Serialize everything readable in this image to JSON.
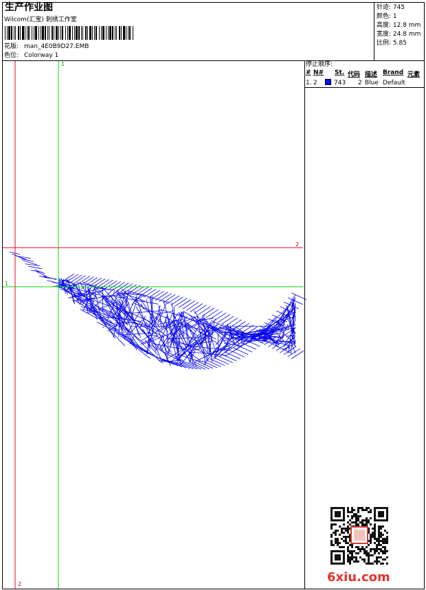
{
  "header": {
    "title": "生产作业图",
    "company": "Wilcom(汇宝) 刺绣工作室",
    "design_label": "花版:",
    "design_value": "man_4E0B9D27.EMB",
    "colorway_label": "色位:",
    "colorway_value": "Colorway 1"
  },
  "stats": [
    {
      "label": "针迹:",
      "value": "745"
    },
    {
      "label": "颜色:",
      "value": "1"
    },
    {
      "label": "高度:",
      "value": "12.8 mm"
    },
    {
      "label": "宽度:",
      "value": "24.8 mm"
    },
    {
      "label": "比例:",
      "value": "5.85"
    }
  ],
  "stop_sequence": {
    "title": "停止顺序:",
    "columns": [
      "#",
      "N#",
      "St.",
      "代码",
      "描述",
      "Brand",
      "元素"
    ],
    "rows": [
      {
        "index": "1.",
        "needle": "2",
        "stitches": "743",
        "code": "2",
        "description": "Blue",
        "brand": "Default"
      }
    ],
    "swatch_color": "#0a10ff"
  },
  "guides": {
    "vertical_red_label": "2",
    "vertical_green_label": "1",
    "horizontal_red_label": "2",
    "horizontal_green_label": "1",
    "red_color": "#e8001c",
    "green_color": "#00d800"
  },
  "design_color": "#0000ee",
  "watermark": "6xiu.com"
}
